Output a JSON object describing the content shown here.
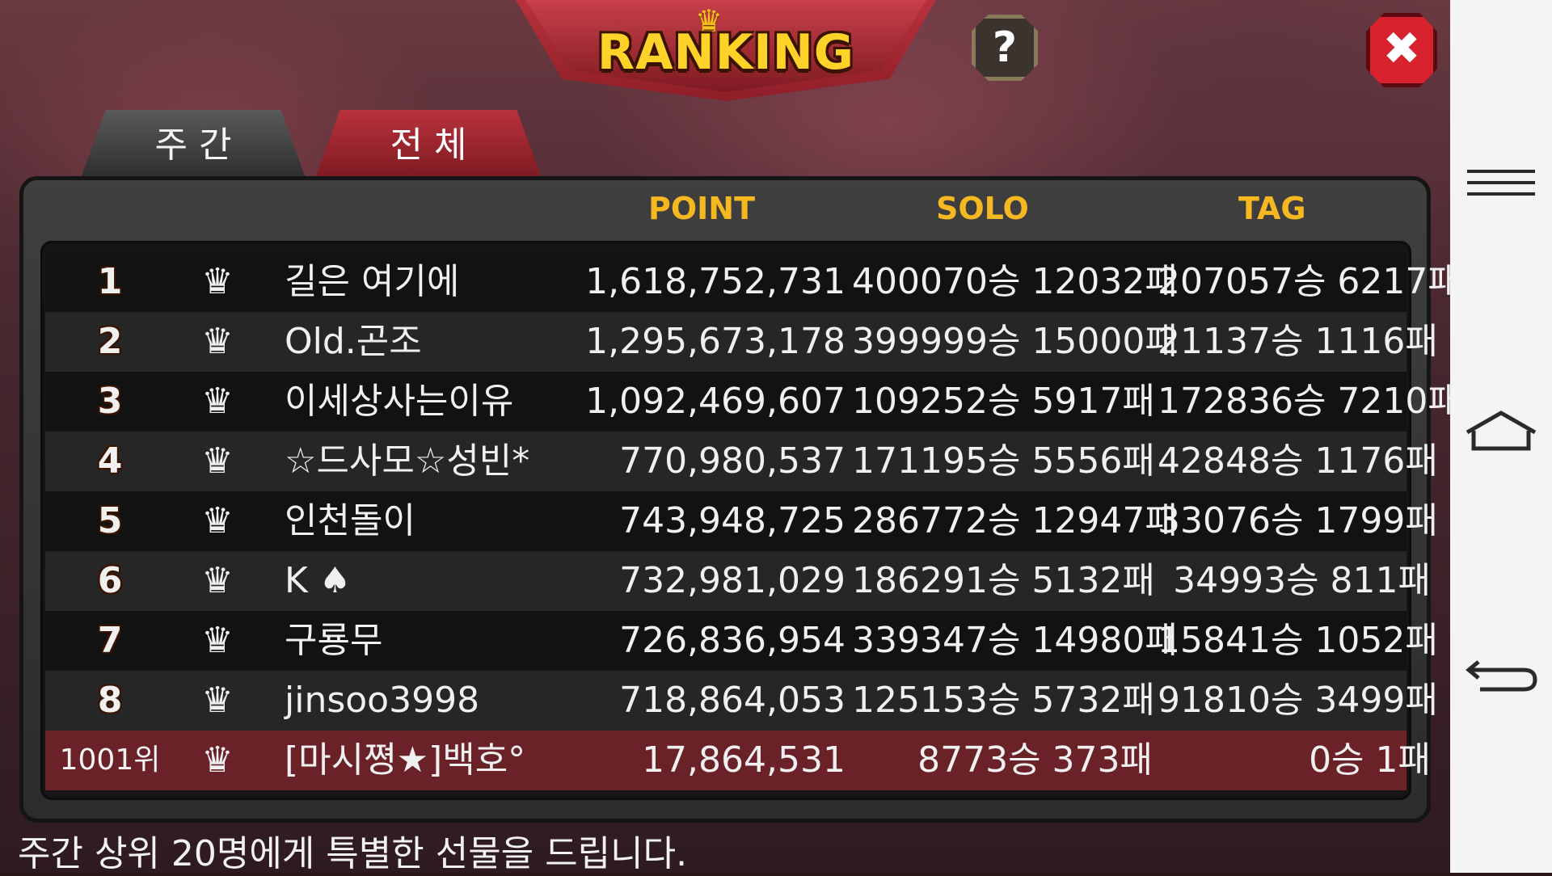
{
  "title": "RANKING",
  "help_label": "?",
  "close_label": "✖",
  "tabs": [
    {
      "label": "주 간",
      "active": false
    },
    {
      "label": "전 체",
      "active": true
    }
  ],
  "columns": {
    "point": "POINT",
    "solo": "SOLO",
    "tag": "TAG"
  },
  "rows": [
    {
      "rank": "1",
      "crown": "gold",
      "name": "길은 여기에",
      "point": "1,618,752,731",
      "solo": "400070승 12032패",
      "tag": "207057승 6217패"
    },
    {
      "rank": "2",
      "crown": "silver",
      "name": "Old.곤조",
      "point": "1,295,673,178",
      "solo": "399999승 15000패",
      "tag": "21137승 1116패"
    },
    {
      "rank": "3",
      "crown": "silver",
      "name": "이세상사는이유",
      "point": "1,092,469,607",
      "solo": "109252승 5917패",
      "tag": "172836승 7210패"
    },
    {
      "rank": "4",
      "crown": "silver",
      "name": "☆드사모☆성빈*",
      "point": "770,980,537",
      "solo": "171195승 5556패",
      "tag": "42848승 1176패"
    },
    {
      "rank": "5",
      "crown": "silver",
      "name": "인천돌이",
      "point": "743,948,725",
      "solo": "286772승 12947패",
      "tag": "33076승 1799패"
    },
    {
      "rank": "6",
      "crown": "silver",
      "name": "K ♠",
      "point": "732,981,029",
      "solo": "186291승 5132패",
      "tag": "34993승 811패"
    },
    {
      "rank": "7",
      "crown": "silver",
      "name": "구룡무",
      "point": "726,836,954",
      "solo": "339347승 14980패",
      "tag": "15841승 1052패"
    },
    {
      "rank": "8",
      "crown": "silver",
      "name": "jinsoo3998",
      "point": "718,864,053",
      "solo": "125153승 5732패",
      "tag": "91810승 3499패"
    }
  ],
  "my_row": {
    "rank": "1001위",
    "crown": "bronze",
    "name": "[마시쪙★]백호°",
    "point": "17,864,531",
    "solo": "8773승 373패",
    "tag": "0승 1패"
  },
  "footer": "주간 상위 20명에게 특별한 선물을 드립니다.",
  "colors": {
    "accent": "#f6b820",
    "banner": "#b8323c",
    "my_row": "#6a2228",
    "rank": "#f57a10"
  }
}
